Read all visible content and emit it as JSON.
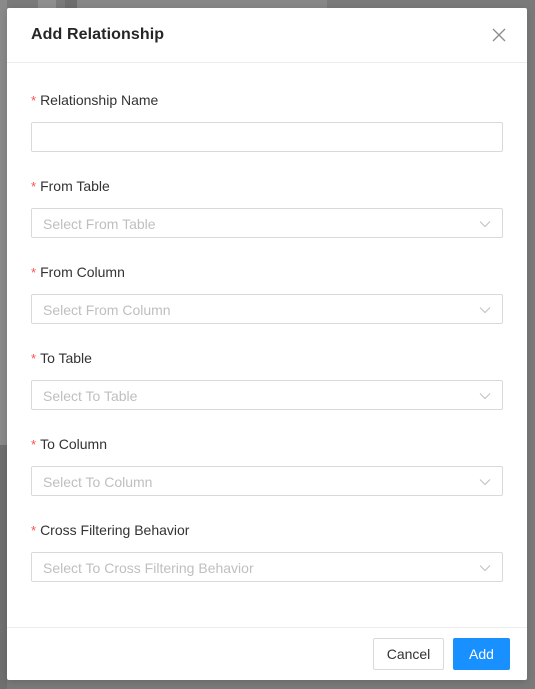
{
  "modal": {
    "title": "Add Relationship",
    "close_icon": "close-icon"
  },
  "fields": [
    {
      "label": "Relationship Name",
      "required_mark": "*",
      "type": "input",
      "value": "",
      "placeholder": ""
    },
    {
      "label": "From Table",
      "required_mark": "*",
      "type": "select",
      "placeholder": "Select From Table"
    },
    {
      "label": "From Column",
      "required_mark": "*",
      "type": "select",
      "placeholder": "Select From Column"
    },
    {
      "label": "To Table",
      "required_mark": "*",
      "type": "select",
      "placeholder": "Select To Table"
    },
    {
      "label": "To Column",
      "required_mark": "*",
      "type": "select",
      "placeholder": "Select To Column"
    },
    {
      "label": "Cross Filtering Behavior",
      "required_mark": "*",
      "type": "select",
      "placeholder": "Select To Cross Filtering Behavior"
    }
  ],
  "footer": {
    "cancel_label": "Cancel",
    "add_label": "Add"
  },
  "colors": {
    "primary": "#1890ff",
    "required": "#ff4d4f",
    "placeholder": "#bfbfbf",
    "border": "#d9d9d9"
  }
}
